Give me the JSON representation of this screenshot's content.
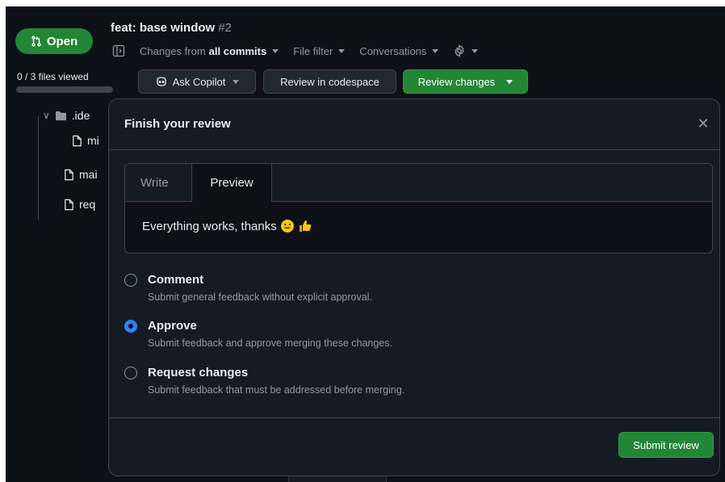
{
  "header": {
    "status": "Open",
    "title": "feat: base window",
    "number": "#2",
    "changes_prefix": "Changes from",
    "changes_value": "all commits",
    "file_filter": "File filter",
    "conversations": "Conversations",
    "files_viewed": "0 / 3 files viewed",
    "files_viewed_fraction": 0
  },
  "actions": {
    "ask_copilot": "Ask Copilot",
    "review_codespace": "Review in codespace",
    "review_changes": "Review changes"
  },
  "tree": {
    "items": [
      ".ide",
      "mi",
      "mai",
      "req"
    ]
  },
  "modal": {
    "title": "Finish your review",
    "tab_write": "Write",
    "tab_preview": "Preview",
    "preview_text": "Everything works, thanks",
    "options": [
      {
        "label": "Comment",
        "desc": "Submit general feedback without explicit approval."
      },
      {
        "label": "Approve",
        "desc": "Submit feedback and approve merging these changes."
      },
      {
        "label": "Request changes",
        "desc": "Submit feedback that must be addressed before merging."
      }
    ],
    "selected_option": "Approve",
    "submit": "Submit review"
  },
  "colors": {
    "accent_green": "#238636",
    "radio_blue": "#2f81f7",
    "background": "#0d1117",
    "panel": "#151b23"
  }
}
